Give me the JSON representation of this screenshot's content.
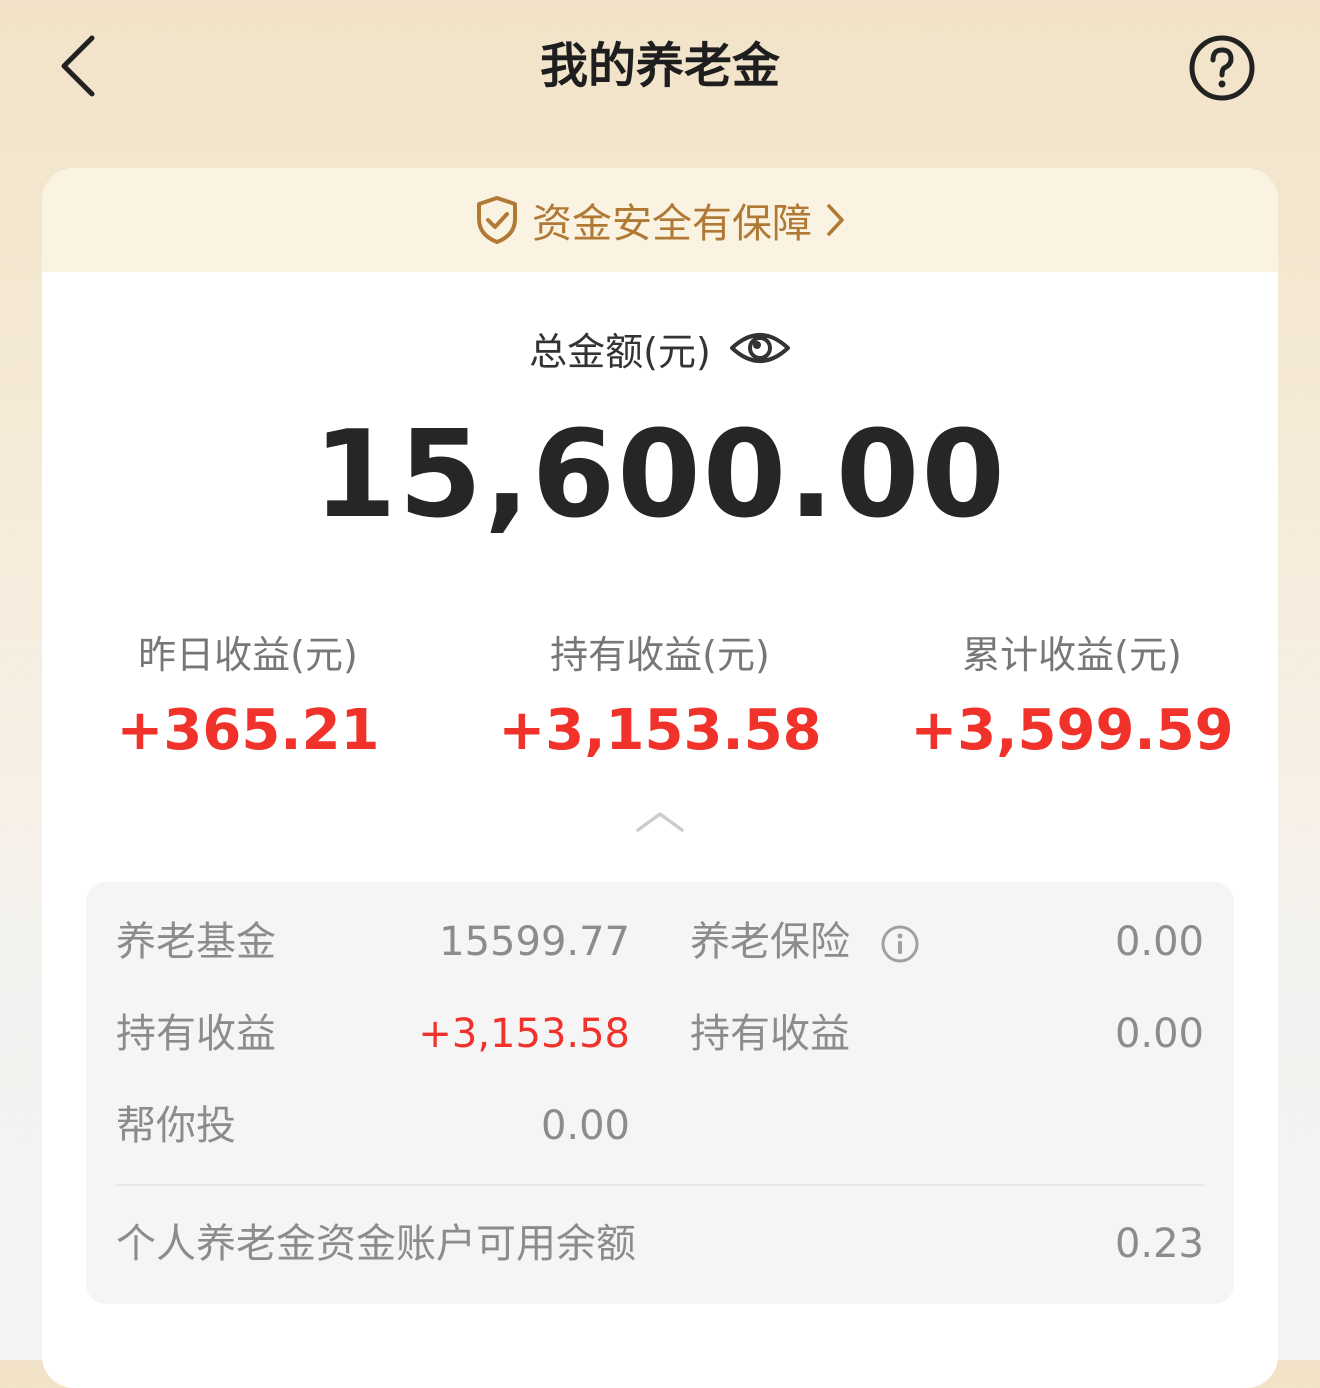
{
  "header": {
    "title": "我的养老金",
    "back_icon": "chevron-left-icon",
    "help_icon": "question-circle-icon"
  },
  "safety_banner": {
    "text": "资金安全有保障",
    "icon": "shield-check-icon",
    "arrow_icon": "chevron-right-icon",
    "color": "#b07a36"
  },
  "total": {
    "label": "总金额(元)",
    "visibility_icon": "eye-icon",
    "amount": "15,600.00"
  },
  "stats": [
    {
      "label": "昨日收益(元)",
      "value": "+365.21"
    },
    {
      "label": "持有收益(元)",
      "value": "+3,153.58"
    },
    {
      "label": "累计收益(元)",
      "value": "+3,599.59"
    }
  ],
  "collapse_icon": "chevron-up-icon",
  "details": {
    "fund": {
      "label": "养老基金",
      "value": "15599.77",
      "holding_label": "持有收益",
      "holding_value": "+3,153.58"
    },
    "insurance": {
      "label": "养老保险",
      "info_icon": "info-icon",
      "value": "0.00",
      "holding_label": "持有收益",
      "holding_value": "0.00"
    },
    "help_invest": {
      "label": "帮你投",
      "value": "0.00"
    },
    "account_balance": {
      "label": "个人养老金资金账户可用余额",
      "value": "0.23"
    }
  },
  "colors": {
    "gain_red": "#f0322a",
    "banner_bg": "#fbf3e2",
    "page_top": "#f2e3c8"
  }
}
